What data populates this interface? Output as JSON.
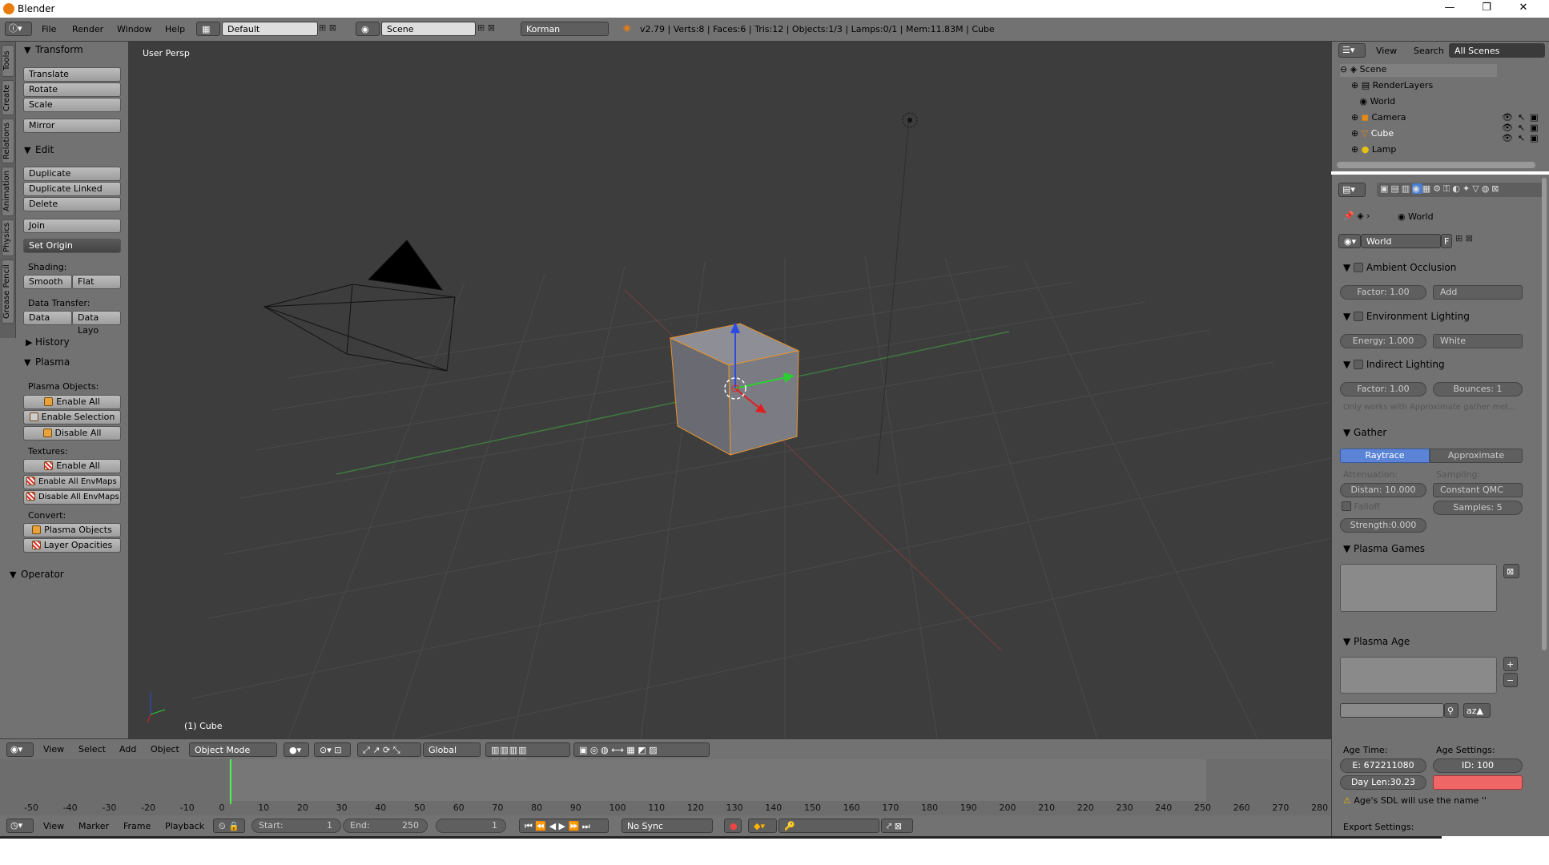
{
  "window": {
    "title": "Blender",
    "min": "—",
    "max": "❐",
    "close": "✕"
  },
  "topbar": {
    "menus": [
      "File",
      "Render",
      "Window",
      "Help"
    ],
    "screen": "Default",
    "scene": "Scene",
    "engine": "Korman",
    "stats": "v2.79 | Verts:8 | Faces:6 | Tris:12 | Objects:1/3 | Lamps:0/1 | Mem:11.83M | Cube"
  },
  "tabs": [
    "Tools",
    "Create",
    "Relations",
    "Animation",
    "Physics",
    "Grease Pencil"
  ],
  "toolshelf": {
    "transform": {
      "title": "Transform",
      "buttons": [
        "Translate",
        "Rotate",
        "Scale",
        "Mirror"
      ]
    },
    "edit": {
      "title": "Edit",
      "buttons": [
        "Duplicate",
        "Duplicate Linked",
        "Delete",
        "Join"
      ],
      "set_origin": "Set Origin",
      "shading_label": "Shading:",
      "smooth": "Smooth",
      "flat": "Flat",
      "data_transfer_label": "Data Transfer:",
      "data": "Data",
      "data_layo": "Data Layo"
    },
    "history": {
      "title": "History"
    },
    "plasma": {
      "title": "Plasma",
      "objects_label": "Plasma Objects:",
      "enable_all": "Enable All",
      "enable_selection": "Enable Selection",
      "disable_all": "Disable All",
      "textures_label": "Textures:",
      "tex_enable_all": "Enable All",
      "enable_envmaps": "Enable All EnvMaps",
      "disable_envmaps": "Disable All EnvMaps",
      "convert_label": "Convert:",
      "plasma_objects": "Plasma Objects",
      "layer_opacities": "Layer Opacities"
    },
    "operator": {
      "title": "Operator"
    }
  },
  "viewport": {
    "view_label": "User Persp",
    "object_label": "(1) Cube"
  },
  "vhdr": {
    "menus": [
      "View",
      "Select",
      "Add",
      "Object"
    ],
    "mode": "Object Mode",
    "orientation": "Global"
  },
  "timeline": {
    "ticks": [
      "-50",
      "-40",
      "-30",
      "-20",
      "-10",
      "0",
      "10",
      "20",
      "30",
      "40",
      "50",
      "60",
      "70",
      "80",
      "90",
      "100",
      "110",
      "120",
      "130",
      "140",
      "150",
      "160",
      "170",
      "180",
      "190",
      "200",
      "210",
      "220",
      "230",
      "240",
      "250",
      "260",
      "270",
      "280"
    ]
  },
  "tlhdr": {
    "menus": [
      "View",
      "Marker",
      "Frame",
      "Playback"
    ],
    "start_label": "Start:",
    "start": "1",
    "end_label": "End:",
    "end": "250",
    "current": "1",
    "sync": "No Sync"
  },
  "outliner": {
    "menus": [
      "View",
      "Search"
    ],
    "filter": "All Scenes",
    "items": [
      "Scene",
      "RenderLayers",
      "World",
      "Camera",
      "Cube",
      "Lamp"
    ]
  },
  "props": {
    "breadcrumb": "World",
    "world_name": "World",
    "fake": "F",
    "ao": {
      "title": "Ambient Occlusion",
      "factor": "Factor:   1.00",
      "mode": "Add"
    },
    "env": {
      "title": "Environment Lighting",
      "energy": "Energy:  1.000",
      "color": "White"
    },
    "indirect": {
      "title": "Indirect Lighting",
      "factor": "Factor:   1.00",
      "bounces": "Bounces:     1",
      "note": "Only works with Approximate gather met..."
    },
    "gather": {
      "title": "Gather",
      "raytrace": "Raytrace",
      "approximate": "Approximate",
      "attenuation": "Attenuation:",
      "sampling": "Sampling:",
      "distance": "Distan: 10.000",
      "qmc": "Constant QMC",
      "falloff": "Falloff",
      "samples": "Samples:     5",
      "strength": "Strength:0.000"
    },
    "games": {
      "title": "Plasma Games"
    },
    "age": {
      "title": "Plasma Age",
      "age_time": "Age Time:",
      "age_settings": "Age Settings:",
      "epoch": "E: 672211080",
      "id": "ID:       100",
      "daylen": "Day Len:30.23",
      "warning": "Age's SDL will use the name ''",
      "export": "Export Settings:"
    }
  }
}
